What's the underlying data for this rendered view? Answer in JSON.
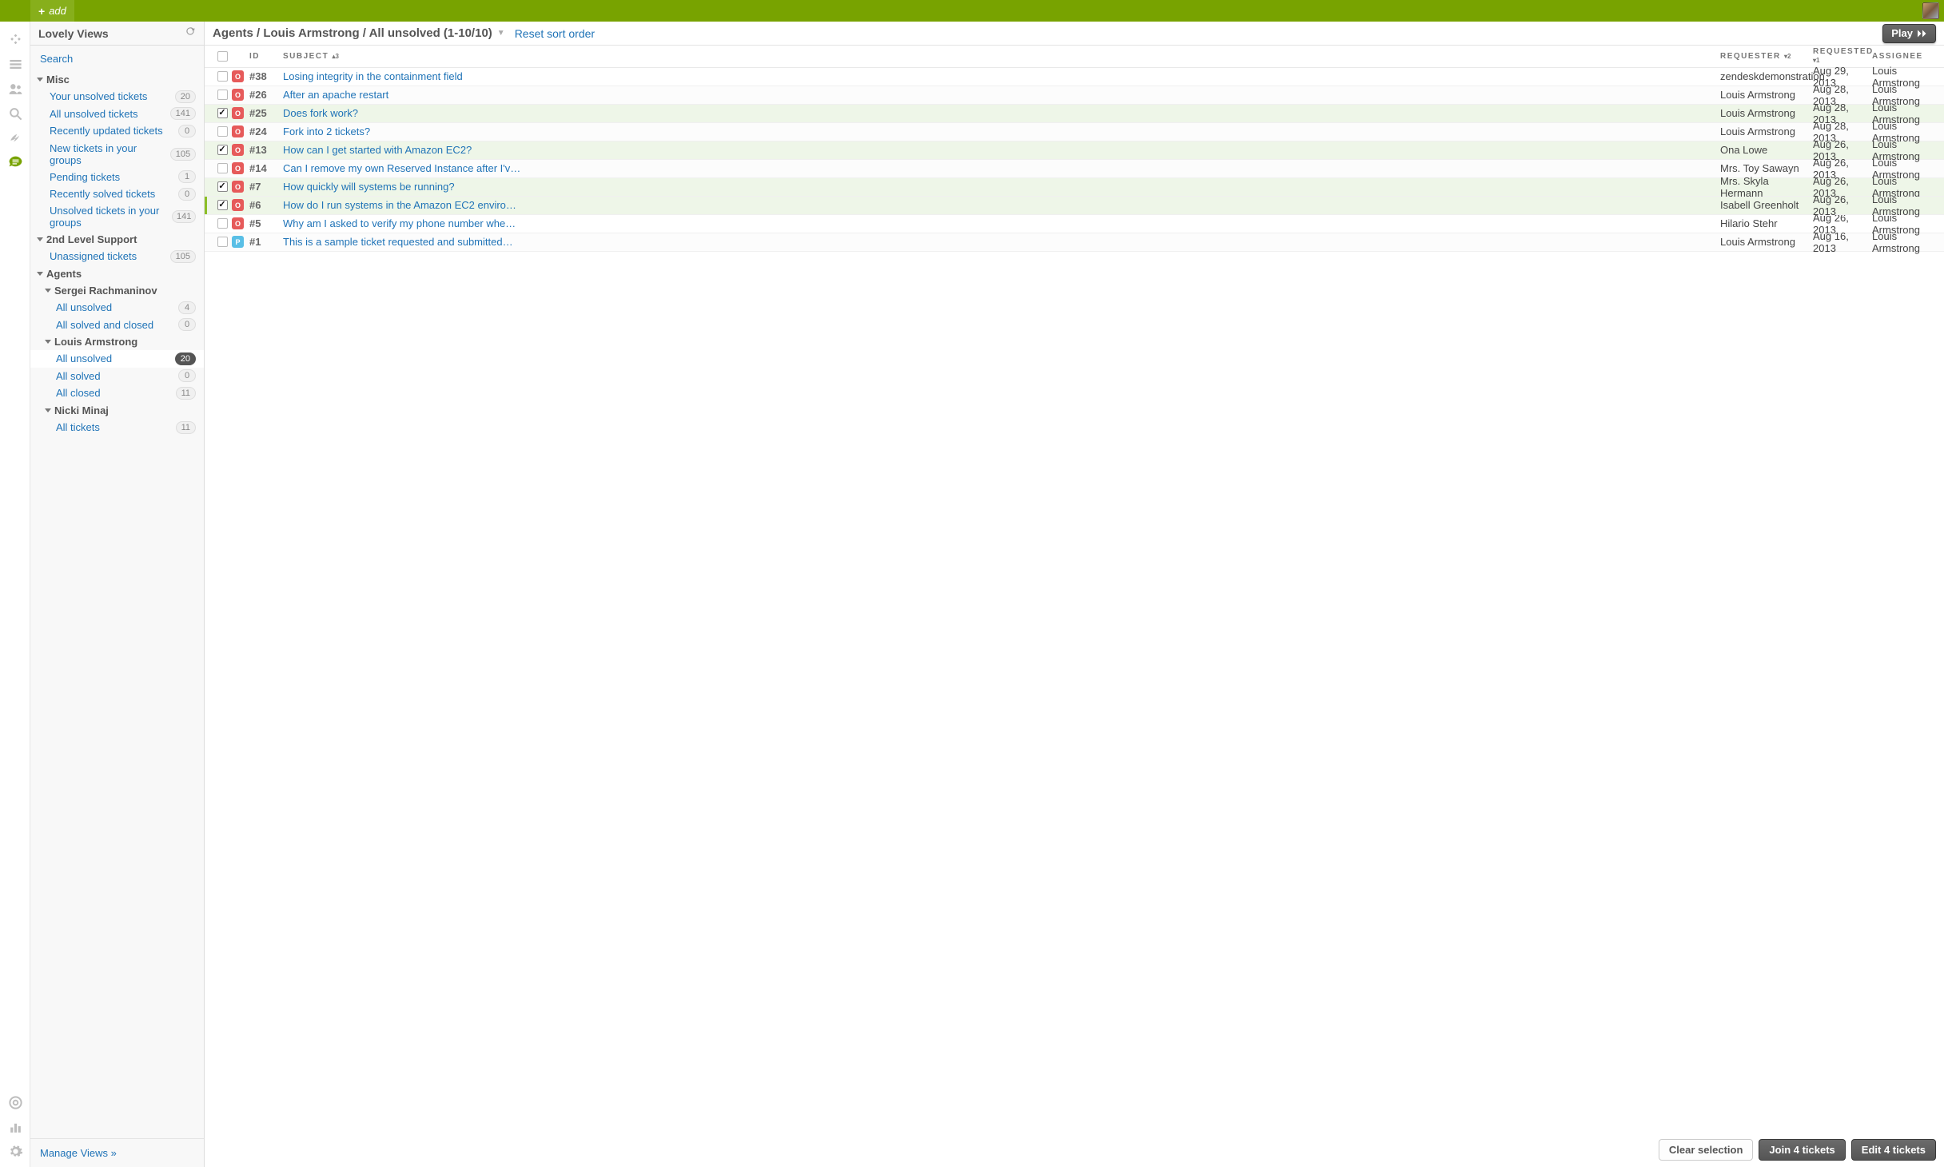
{
  "topbar": {
    "add_label": "add"
  },
  "sidebar": {
    "title": "Lovely Views",
    "search_label": "Search",
    "manage_label": "Manage Views »",
    "groups": [
      {
        "name": "Misc",
        "items": [
          {
            "label": "Your unsolved tickets",
            "count": "20"
          },
          {
            "label": "All unsolved tickets",
            "count": "141"
          },
          {
            "label": "Recently updated tickets",
            "count": "0"
          },
          {
            "label": "New tickets in your groups",
            "count": "105"
          },
          {
            "label": "Pending tickets",
            "count": "1"
          },
          {
            "label": "Recently solved tickets",
            "count": "0"
          },
          {
            "label": "Unsolved tickets in your groups",
            "count": "141"
          }
        ]
      },
      {
        "name": "2nd Level Support",
        "items": [
          {
            "label": "Unassigned tickets",
            "count": "105"
          }
        ]
      },
      {
        "name": "Agents",
        "agents": [
          {
            "name": "Sergei Rachmaninov",
            "items": [
              {
                "label": "All unsolved",
                "count": "4"
              },
              {
                "label": "All solved and closed",
                "count": "0"
              }
            ]
          },
          {
            "name": "Louis Armstrong",
            "items": [
              {
                "label": "All unsolved",
                "count": "20",
                "current": true
              },
              {
                "label": "All solved",
                "count": "0"
              },
              {
                "label": "All closed",
                "count": "11"
              }
            ]
          },
          {
            "name": "Nicki Minaj",
            "items": [
              {
                "label": "All tickets",
                "count": "11"
              }
            ]
          }
        ]
      }
    ]
  },
  "main": {
    "breadcrumb": "Agents / Louis Armstrong / All unsolved (1-10/10)",
    "reset_label": "Reset sort order",
    "play_label": "Play",
    "columns": {
      "id": "ID",
      "subject": "SUBJECT",
      "subject_sort": "▴3",
      "requester": "REQUESTER",
      "requester_sort": "▾2",
      "requested": "REQUESTED",
      "requested_sort": "▾1",
      "assignee": "ASSIGNEE"
    },
    "rows": [
      {
        "checked": false,
        "status": "o",
        "id": "#38",
        "subject": "Losing integrity in the containment field",
        "requester": "zendeskdemonstration",
        "requested": "Aug 29, 2013",
        "assignee": "Louis Armstrong"
      },
      {
        "checked": false,
        "status": "o",
        "id": "#26",
        "subject": "After an apache restart",
        "requester": "Louis Armstrong",
        "requested": "Aug 28, 2013",
        "assignee": "Louis Armstrong"
      },
      {
        "checked": true,
        "status": "o",
        "id": "#25",
        "subject": "Does fork work?",
        "requester": "Louis Armstrong",
        "requested": "Aug 28, 2013",
        "assignee": "Louis Armstrong"
      },
      {
        "checked": false,
        "status": "o",
        "id": "#24",
        "subject": "Fork into 2 tickets?",
        "requester": "Louis Armstrong",
        "requested": "Aug 28, 2013",
        "assignee": "Louis Armstrong"
      },
      {
        "checked": true,
        "status": "o",
        "id": "#13",
        "subject": "How can I get started with Amazon EC2?",
        "requester": "Ona Lowe",
        "requested": "Aug 26, 2013",
        "assignee": "Louis Armstrong"
      },
      {
        "checked": false,
        "status": "o",
        "id": "#14",
        "subject": "Can I remove my own Reserved Instance after I'v…",
        "requester": "Mrs. Toy Sawayn",
        "requested": "Aug 26, 2013",
        "assignee": "Louis Armstrong"
      },
      {
        "checked": true,
        "status": "o",
        "id": "#7",
        "subject": "How quickly will systems be running?",
        "requester": "Mrs. Skyla Hermann",
        "requested": "Aug 26, 2013",
        "assignee": "Louis Armstrong"
      },
      {
        "checked": true,
        "status": "o",
        "id": "#6",
        "subject": "How do I run systems in the Amazon EC2 enviro…",
        "requester": "Isabell Greenholt",
        "requested": "Aug 26, 2013",
        "assignee": "Louis Armstrong",
        "focused": true
      },
      {
        "checked": false,
        "status": "o",
        "id": "#5",
        "subject": "Why am I asked to verify my phone number whe…",
        "requester": "Hilario Stehr",
        "requested": "Aug 26, 2013",
        "assignee": "Louis Armstrong"
      },
      {
        "checked": false,
        "status": "p",
        "id": "#1",
        "subject": "This is a sample ticket requested and submitted…",
        "requester": "Louis Armstrong",
        "requested": "Aug 16, 2013",
        "assignee": "Louis Armstrong"
      }
    ],
    "actions": {
      "clear": "Clear selection",
      "join": "Join 4 tickets",
      "edit": "Edit 4 tickets"
    }
  }
}
